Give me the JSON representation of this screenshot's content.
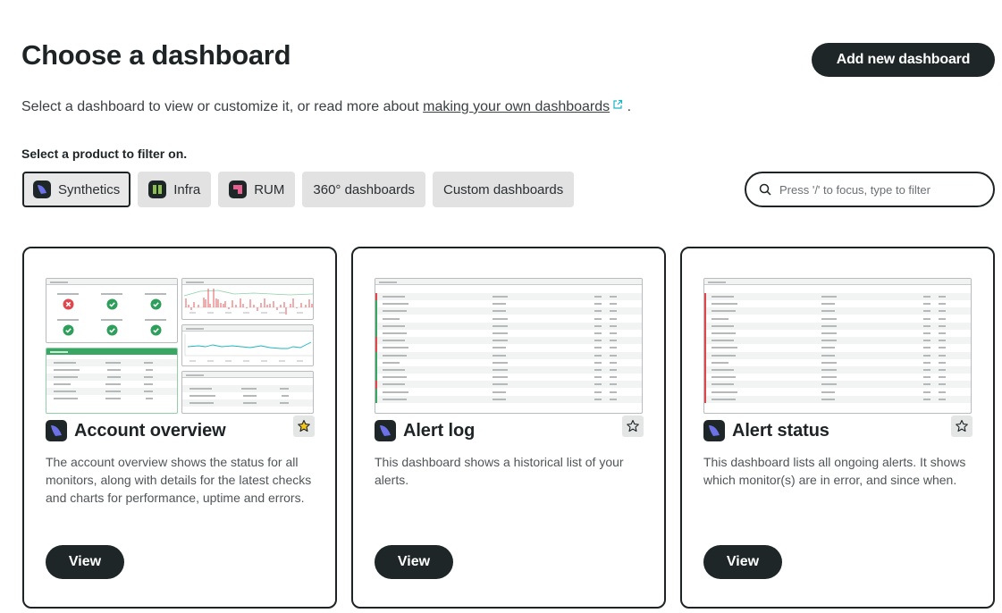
{
  "header": {
    "title": "Choose a dashboard",
    "add_button": "Add new dashboard",
    "subtitle_prefix": "Select a dashboard to view or customize it, or read more about ",
    "subtitle_link": "making your own dashboards",
    "subtitle_suffix": " ."
  },
  "filters": {
    "label": "Select a product to filter on.",
    "chips": [
      {
        "label": "Synthetics",
        "icon": "synthetics-icon",
        "active": true
      },
      {
        "label": "Infra",
        "icon": "infra-icon",
        "active": false
      },
      {
        "label": "RUM",
        "icon": "rum-icon",
        "active": false
      },
      {
        "label": "360° dashboards",
        "icon": null,
        "active": false
      },
      {
        "label": "Custom dashboards",
        "icon": null,
        "active": false
      }
    ],
    "search_placeholder": "Press '/' to focus, type to filter"
  },
  "cards": [
    {
      "title": "Account overview",
      "description": "The account overview shows the status for all monitors, along with details for the latest checks and charts for performance, uptime and errors.",
      "favorited": true,
      "view_label": "View"
    },
    {
      "title": "Alert log",
      "description": "This dashboard shows a historical list of your alerts.",
      "favorited": false,
      "view_label": "View"
    },
    {
      "title": "Alert status",
      "description": "This dashboard lists all ongoing alerts. It shows which monitor(s) are in error, and since when.",
      "favorited": false,
      "view_label": "View"
    }
  ],
  "colors": {
    "primary_dark": "#1e2628",
    "synthetics_accent": "#6b72e8",
    "infra_accent": "#8cc04f",
    "rum_accent": "#e8608f",
    "success": "#2e9e5b",
    "error": "#e0474c",
    "chart_teal": "#1fb5c4",
    "star_gold": "#f5c518",
    "link_icon": "#19b4c4"
  }
}
